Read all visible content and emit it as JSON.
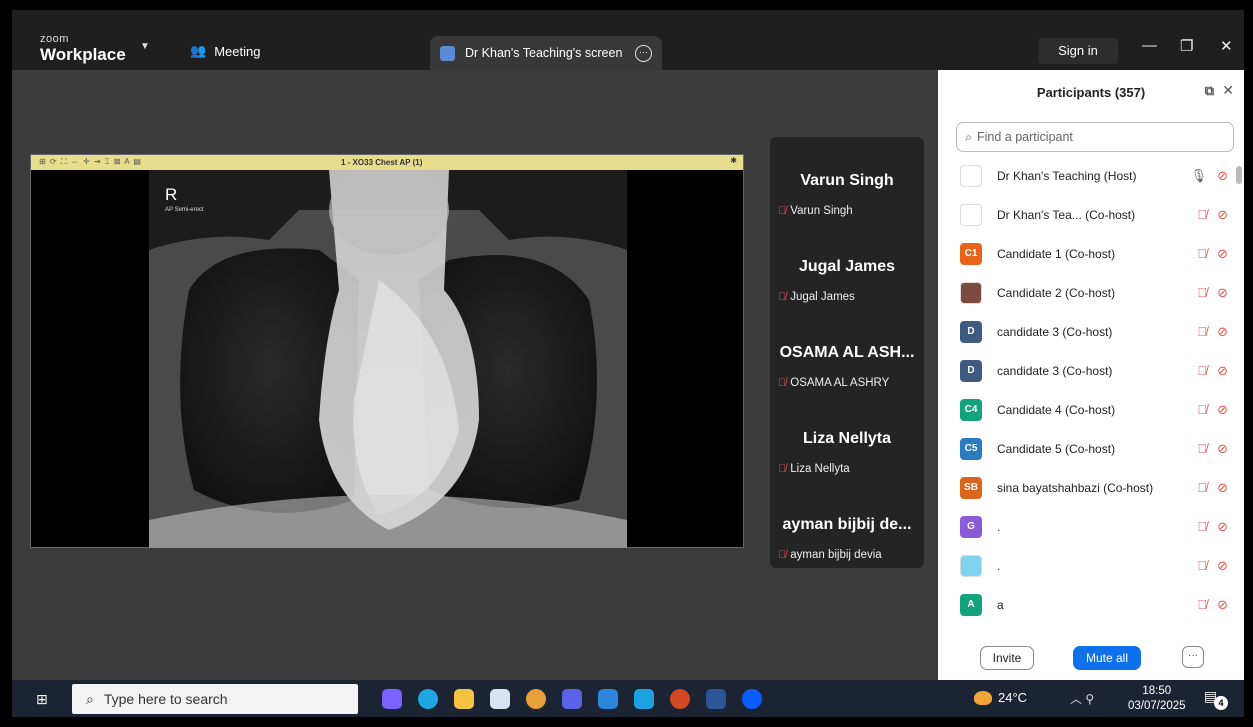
{
  "titlebar": {
    "logo_small": "zoom",
    "logo_big": "Workplace",
    "meeting_label": "Meeting",
    "share_tab_label": "Dr Khan's Teaching's screen",
    "sign_in": "Sign in",
    "minimize": "—",
    "restore": "❐",
    "close": "✕"
  },
  "viewer": {
    "toolbar_title": "1 - XO33 Chest AP (1)",
    "toolbar_tools": "⊞  ⟳ ⛶ ⇔ ✛ ⇥ ⌶ ⊠ A ▤",
    "gear": "✱",
    "label_r": "R",
    "label_sub": "AP Semi-erect"
  },
  "video_tiles": [
    {
      "display": "Varun Singh",
      "sub": "Varun Singh"
    },
    {
      "display": "Jugal James",
      "sub": "Jugal James"
    },
    {
      "display": "OSAMA AL ASH...",
      "sub": "OSAMA AL ASHRY"
    },
    {
      "display": "Liza Nellyta",
      "sub": "Liza Nellyta"
    },
    {
      "display": "ayman bijbij de...",
      "sub": "ayman bijbij devia"
    }
  ],
  "panel": {
    "title": "Participants (357)",
    "search_placeholder": "Find a participant",
    "participants": [
      {
        "name": "Dr Khan's Teaching (Host)",
        "avatar": "",
        "avatar_color": "#ffffff",
        "mic": "on"
      },
      {
        "name": "Dr Khan's Tea... (Co-host)",
        "avatar": "",
        "avatar_color": "#ffffff",
        "mic": "off"
      },
      {
        "name": "Candidate 1 (Co-host)",
        "avatar": "C1",
        "avatar_color": "#e8641b",
        "mic": "off"
      },
      {
        "name": "Candidate 2 (Co-host)",
        "avatar": "",
        "avatar_color": "#7a4b3e",
        "mic": "off"
      },
      {
        "name": "candidate 3 (Co-host)",
        "avatar": "D",
        "avatar_color": "#3d5a80",
        "mic": "off"
      },
      {
        "name": "candidate 3 (Co-host)",
        "avatar": "D",
        "avatar_color": "#3d5a80",
        "mic": "off"
      },
      {
        "name": "Candidate 4 (Co-host)",
        "avatar": "C4",
        "avatar_color": "#12a37b",
        "mic": "off"
      },
      {
        "name": "Candidate 5 (Co-host)",
        "avatar": "C5",
        "avatar_color": "#2a7bbf",
        "mic": "off"
      },
      {
        "name": "sina bayatshahbazi (Co-host)",
        "avatar": "SB",
        "avatar_color": "#d9651e",
        "mic": "off"
      },
      {
        "name": ".",
        "avatar": "G",
        "avatar_color": "#8a5bd6",
        "mic": "off"
      },
      {
        "name": ".",
        "avatar": "",
        "avatar_color": "#7fd3f0",
        "mic": "off"
      },
      {
        "name": "a",
        "avatar": "A",
        "avatar_color": "#12a37b",
        "mic": "off"
      }
    ],
    "invite": "Invite",
    "mute_all": "Mute all",
    "more": "···"
  },
  "taskbar": {
    "search_placeholder": "Type here to search",
    "temperature": "24°C",
    "time": "18:50",
    "date": "03/07/2025",
    "notification_count": "4"
  }
}
